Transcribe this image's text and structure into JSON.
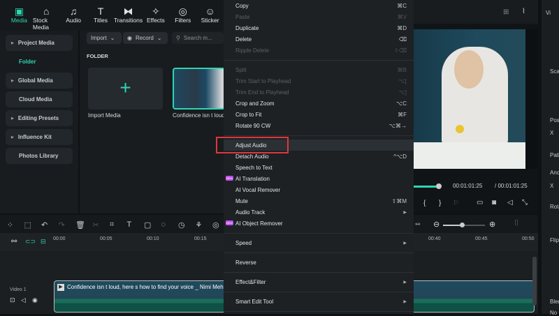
{
  "toolbar": {
    "tabs": [
      {
        "label": "Media",
        "icon": "media-icon",
        "glyph": "▣"
      },
      {
        "label": "Stock Media",
        "icon": "stock-media-icon",
        "glyph": "⌂"
      },
      {
        "label": "Audio",
        "icon": "music-icon",
        "glyph": "♫"
      },
      {
        "label": "Titles",
        "icon": "titles-icon",
        "glyph": "T"
      },
      {
        "label": "Transitions",
        "icon": "transitions-icon",
        "glyph": "⧓"
      },
      {
        "label": "Effects",
        "icon": "effects-icon",
        "glyph": "✧"
      },
      {
        "label": "Filters",
        "icon": "filters-icon",
        "glyph": "◎"
      },
      {
        "label": "Sticker",
        "icon": "sticker-icon",
        "glyph": "☺"
      }
    ]
  },
  "sidebar": {
    "items": [
      {
        "label": "Project Media",
        "expandable": true
      },
      {
        "label": "Folder",
        "active": true
      },
      {
        "label": "Global Media",
        "expandable": true
      },
      {
        "label": "Cloud Media"
      },
      {
        "label": "Editing Presets",
        "expandable": true
      },
      {
        "label": "Influence Kit",
        "expandable": true
      },
      {
        "label": "Photos Library"
      }
    ]
  },
  "media": {
    "import_label": "Import",
    "record_label": "Record",
    "search_placeholder": "Search m...",
    "folder_heading": "FOLDER",
    "import_media_label": "Import Media",
    "clip_name": "Confidence isn t loud"
  },
  "context_menu": {
    "items": [
      {
        "label": "Copy",
        "shortcut": "⌘C"
      },
      {
        "label": "Paste",
        "shortcut": "⌘V",
        "disabled": true
      },
      {
        "label": "Duplicate",
        "shortcut": "⌘D"
      },
      {
        "label": "Delete",
        "shortcut": "⌫"
      },
      {
        "label": "Ripple Delete",
        "shortcut": "⇧⌫",
        "disabled": true
      },
      {
        "separator": true
      },
      {
        "label": "Split",
        "shortcut": "⌘B",
        "disabled": true
      },
      {
        "label": "Trim Start to Playhead",
        "shortcut": "⌥[",
        "disabled": true
      },
      {
        "label": "Trim End to Playhead",
        "shortcut": "⌥]",
        "disabled": true
      },
      {
        "label": "Crop and Zoom",
        "shortcut": "⌥C"
      },
      {
        "label": "Crop to Fit",
        "shortcut": "⌘F"
      },
      {
        "label": "Rotate 90 CW",
        "shortcut": "⌥⌘→"
      },
      {
        "separator": true
      },
      {
        "label": "Adjust Audio",
        "highlighted": true
      },
      {
        "label": "Detach Audio",
        "shortcut": "^⌥D"
      },
      {
        "label": "Speech to Text"
      },
      {
        "label": "AI Translation",
        "badge": "NEW"
      },
      {
        "label": "AI Vocal Remover"
      },
      {
        "label": "Mute",
        "shortcut": "⇧⌘M"
      },
      {
        "label": "Audio Track",
        "submenu": true
      },
      {
        "label": "AI Object Remover",
        "badge": "NEW"
      },
      {
        "separator": true
      },
      {
        "label": "Speed",
        "submenu": true
      },
      {
        "separator": true
      },
      {
        "label": "Reverse"
      },
      {
        "separator": true
      },
      {
        "label": "Effect&Filter",
        "submenu": true
      },
      {
        "separator": true
      },
      {
        "label": "Smart Edit Tool",
        "submenu": true
      },
      {
        "separator": true
      }
    ]
  },
  "preview": {
    "current_time": "00:01:01:25",
    "total_time": "/ 00:01:01:25",
    "progress": 1.0
  },
  "right_panel": {
    "labels": [
      "Vi",
      "Sca",
      "Pos",
      "X",
      "Path",
      "Anc",
      "X",
      "Rota",
      "Flip",
      "Blen",
      "No"
    ]
  },
  "timeline": {
    "ruler": [
      "00:00",
      "00:05",
      "00:10",
      "00:15",
      "00:40",
      "00:45",
      "00:50"
    ],
    "track_label": "Video 1",
    "clip_title": "Confidence isn t loud, here s how to find your voice _ Nimi Mehta",
    "zoom_level": 0.45
  },
  "colors": {
    "accent": "#2ed6b0",
    "highlight_box": "#e0363b",
    "menu_bg": "#1d2124"
  }
}
